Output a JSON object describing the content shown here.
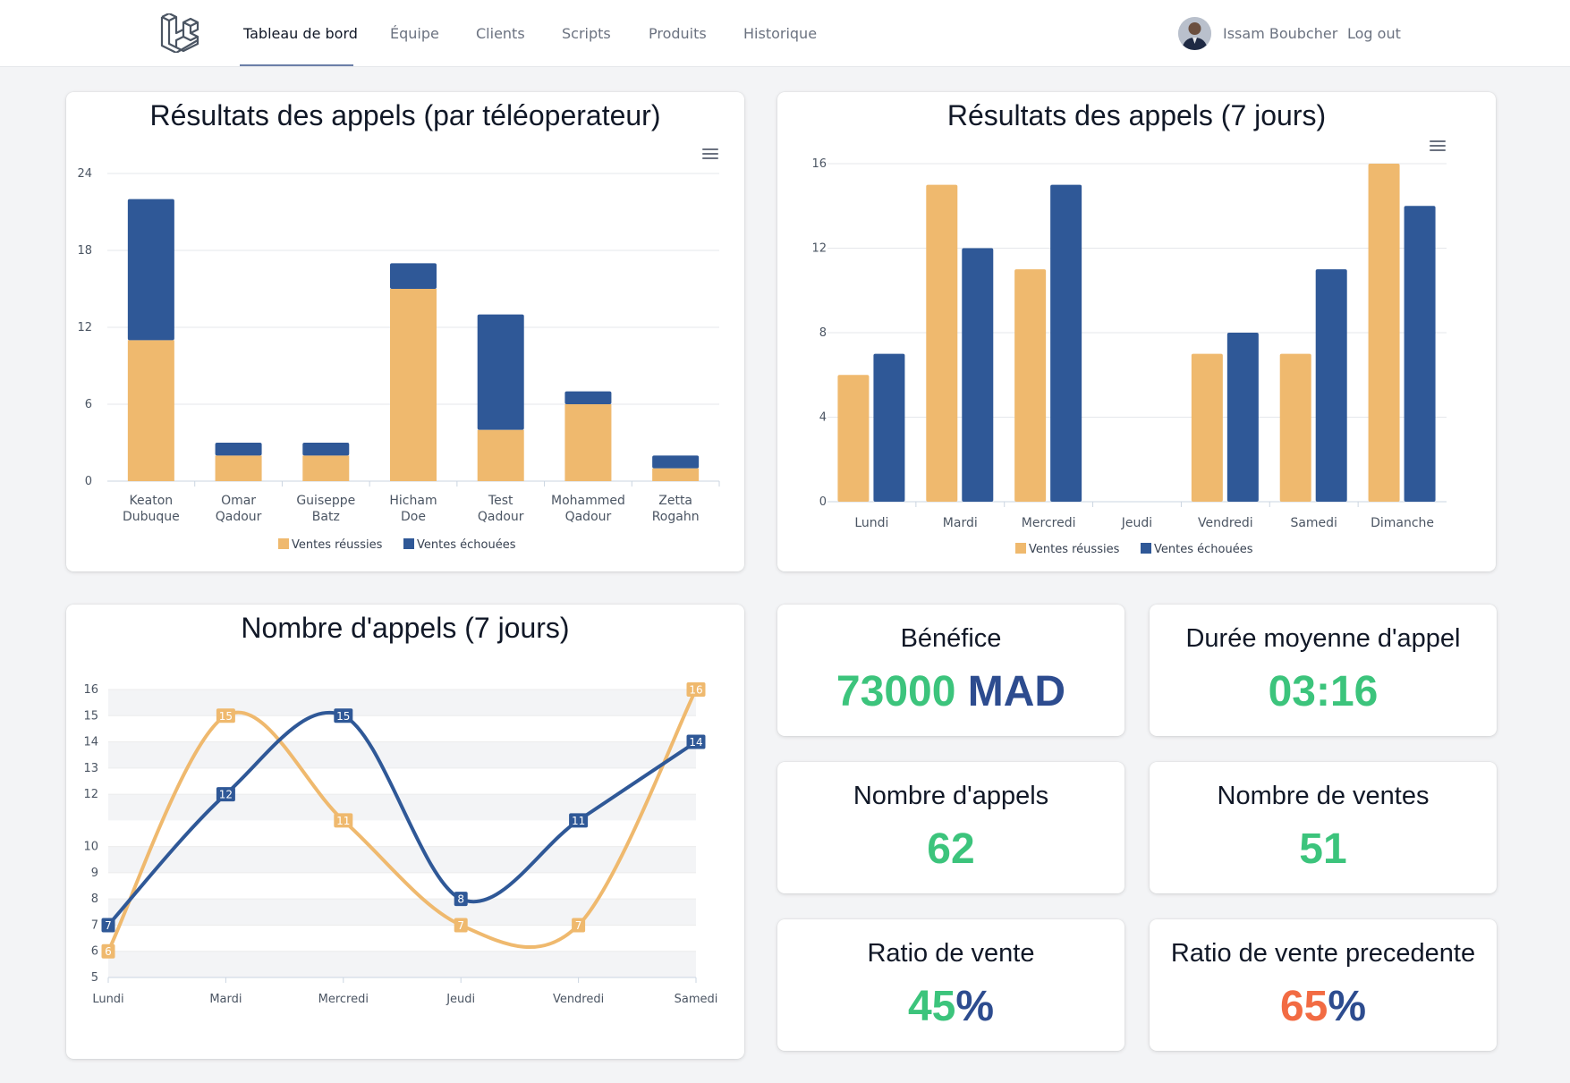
{
  "nav": {
    "links": [
      "Tableau de bord",
      "Équipe",
      "Clients",
      "Scripts",
      "Produits",
      "Historique"
    ],
    "active_index": 0,
    "user_name": "Issam Boubcher",
    "logout": "Log out"
  },
  "colors": {
    "success": "#efb96e",
    "failure": "#2f5897",
    "green": "#3cc47c",
    "orange": "#f26b43"
  },
  "chart_data": [
    {
      "type": "bar",
      "stacked": true,
      "title": "Résultats des appels (par téléoperateur)",
      "categories": [
        [
          "Keaton",
          "Dubuque"
        ],
        [
          "Omar",
          "Qadour"
        ],
        [
          "Guiseppe",
          "Batz"
        ],
        [
          "Hicham",
          "Doe"
        ],
        [
          "Test",
          "Qadour"
        ],
        [
          "Mohammed",
          "Qadour"
        ],
        [
          "Zetta",
          "Rogahn"
        ]
      ],
      "series": [
        {
          "name": "Ventes réussies",
          "values": [
            11,
            2,
            2,
            15,
            4,
            6,
            1
          ]
        },
        {
          "name": "Ventes échouées",
          "values": [
            11,
            1,
            1,
            2,
            9,
            1,
            1
          ]
        }
      ],
      "ylim": [
        0,
        24
      ],
      "yticks": [
        0,
        6,
        12,
        18,
        24
      ],
      "grid": true,
      "legend": "bottom"
    },
    {
      "type": "bar",
      "stacked": false,
      "title": "Résultats des appels (7 jours)",
      "categories": [
        "Lundi",
        "Mardi",
        "Mercredi",
        "Jeudi",
        "Vendredi",
        "Samedi",
        "Dimanche"
      ],
      "series": [
        {
          "name": "Ventes réussies",
          "values": [
            6,
            15,
            11,
            0,
            7,
            7,
            16
          ]
        },
        {
          "name": "Ventes échouées",
          "values": [
            7,
            12,
            15,
            0,
            8,
            11,
            14
          ]
        }
      ],
      "ylim": [
        0,
        16
      ],
      "yticks": [
        0,
        4,
        8,
        12,
        16
      ],
      "grid": true,
      "legend": "bottom"
    },
    {
      "type": "line",
      "smooth": true,
      "title": "Nombre d'appels (7 jours)",
      "categories": [
        "Lundi",
        "Mardi",
        "Mercredi",
        "Jeudi",
        "Vendredi",
        "Samedi"
      ],
      "series": [
        {
          "name": "Ventes réussies",
          "values": [
            6,
            15,
            11,
            7,
            7,
            16
          ]
        },
        {
          "name": "Ventes échouées",
          "values": [
            7,
            12,
            15,
            8,
            11,
            14
          ]
        }
      ],
      "ylim": [
        5,
        16
      ],
      "yticks": [
        5,
        6,
        7,
        8,
        9,
        10,
        12,
        13,
        14,
        15,
        16
      ],
      "grid": true,
      "data_labels": true
    }
  ],
  "stats": {
    "benefice": {
      "label": "Bénéfice",
      "value": "73000",
      "unit": "MAD"
    },
    "duree": {
      "label": "Durée moyenne d'appel",
      "value": "03:16"
    },
    "appels": {
      "label": "Nombre d'appels",
      "value": "62"
    },
    "ventes": {
      "label": "Nombre de ventes",
      "value": "51"
    },
    "ratio": {
      "label": "Ratio de vente",
      "value": "45",
      "unit": "%"
    },
    "ratio_prec": {
      "label": "Ratio de vente precedente",
      "value": "65",
      "unit": "%"
    }
  }
}
